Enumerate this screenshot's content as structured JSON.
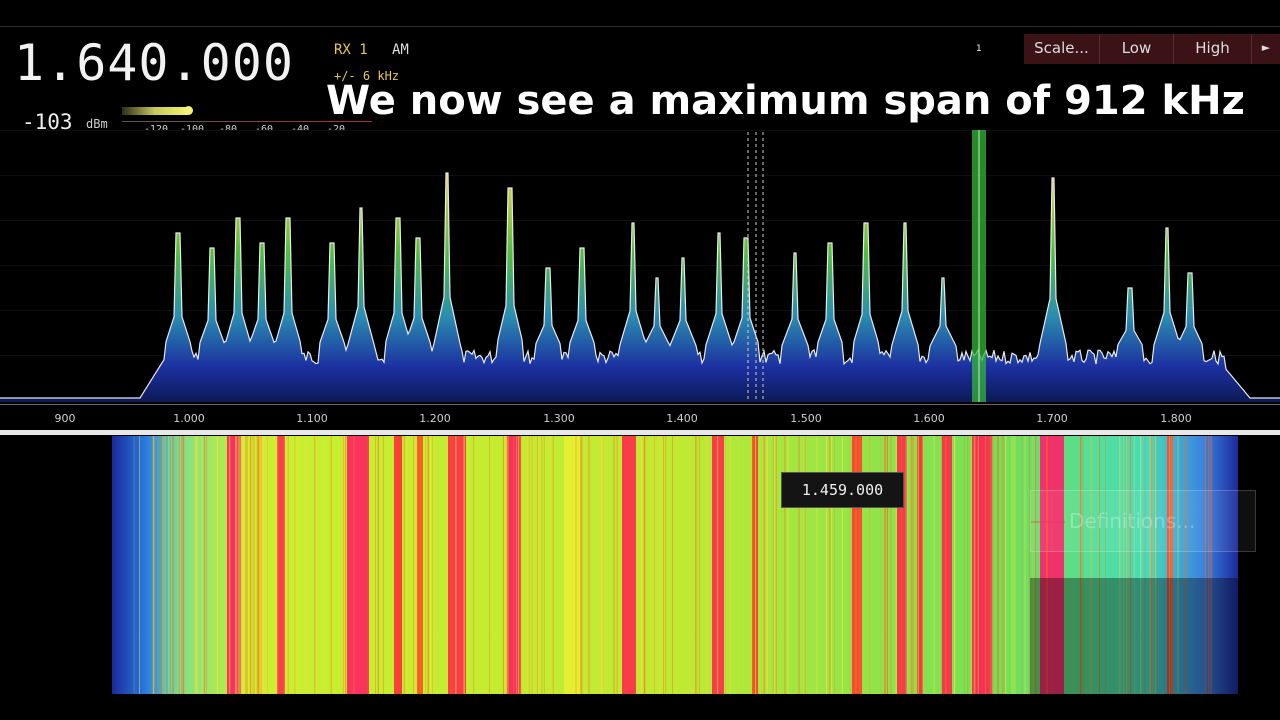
{
  "display": {
    "frequency": "1.640.000",
    "receiver": "RX 1",
    "mode": "AM",
    "bandwidth": "+/- 6 kHz",
    "level": "-103",
    "level_unit": "dBm",
    "smeter_ticks": [
      "-120",
      "-100",
      "-80",
      "-60",
      "-40",
      "-20"
    ],
    "receiver_marker": "1"
  },
  "caption": "We now see a maximum span of 912 kHz",
  "toolbar": {
    "scale_label": "Scale...",
    "low_label": "Low",
    "high_label": "High",
    "more_label": "►"
  },
  "axis": {
    "ticks": [
      "900",
      "1.000",
      "1.100",
      "1.200",
      "1.300",
      "1.400",
      "1.500",
      "1.600",
      "1.700",
      "1.800"
    ]
  },
  "waterfall": {
    "cursor_frequency": "1.459.000",
    "definitions_label": "Definitions..."
  },
  "colors": {
    "accent_yellow": "#e8c94a",
    "toolbar_bg": "#3b1316",
    "marker_green": "#3ec43e"
  }
}
